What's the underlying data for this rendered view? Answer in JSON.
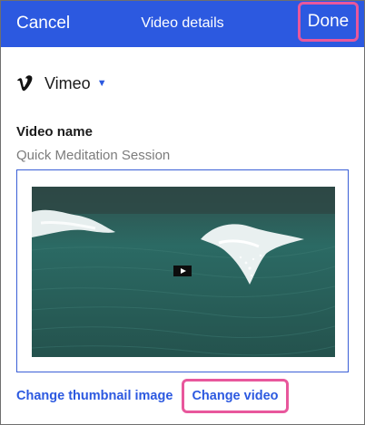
{
  "header": {
    "cancel_label": "Cancel",
    "title": "Video details",
    "done_label": "Done"
  },
  "platform": {
    "name": "Vimeo",
    "icon": "vimeo-logo-icon",
    "caret_icon": "caret-down-icon"
  },
  "video": {
    "name_label": "Video name",
    "name_value": "Quick Meditation Session",
    "play_icon": "play-icon"
  },
  "actions": {
    "change_thumbnail_label": "Change thumbnail image",
    "change_video_label": "Change video"
  },
  "colors": {
    "header_bg": "#2c59e0",
    "link": "#2c59e0",
    "highlight": "#e8579c",
    "ocean": "#2a5650"
  }
}
